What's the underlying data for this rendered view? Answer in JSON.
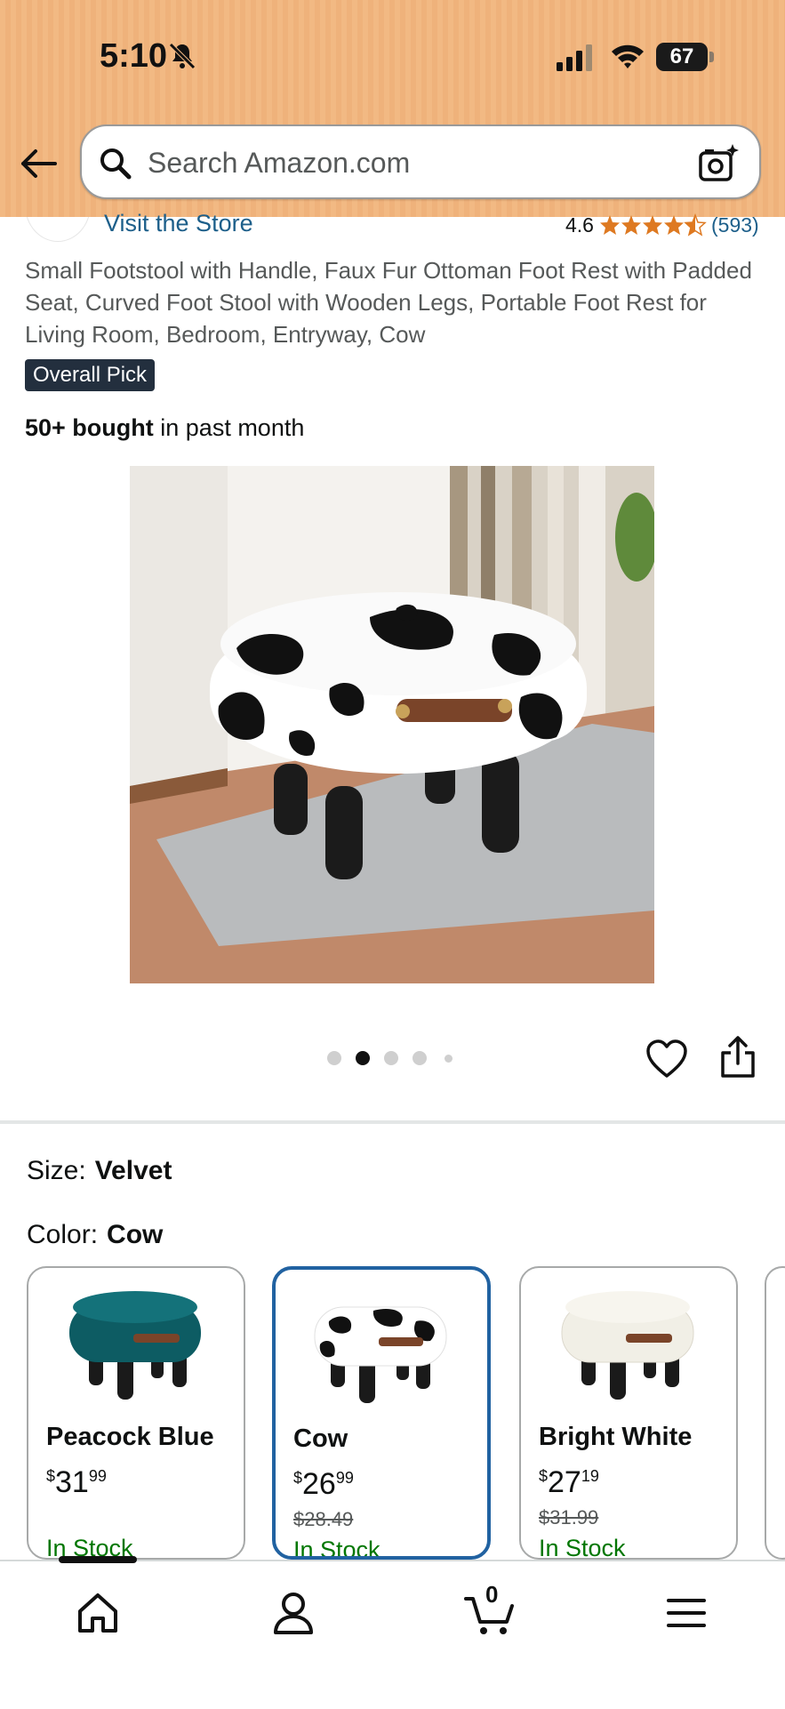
{
  "status_bar": {
    "time": "5:10",
    "battery": "67"
  },
  "search": {
    "placeholder": "Search Amazon.com"
  },
  "store": {
    "visit_label": "Visit the Store",
    "rating": "4.6",
    "review_count": "(593)",
    "stars": 4.5
  },
  "product": {
    "title": "Small Footstool with Handle, Faux Fur Ottoman Foot Rest with Padded Seat, Curved Foot Stool with Wooden Legs, Portable Foot Rest for Living Room, Bedroom, Entryway, Cow",
    "badge": "Overall Pick",
    "bought_bold": "50+ bought",
    "bought_rest": " in past month"
  },
  "carousel": {
    "total": 5,
    "active_index": 1
  },
  "size": {
    "label": "Size:",
    "value": "Velvet"
  },
  "color": {
    "label": "Color:",
    "value": "Cow"
  },
  "swatches": [
    {
      "name": "Peacock Blue",
      "price_symbol": "$",
      "price_whole": "31",
      "price_frac": "99",
      "old_price": "",
      "stock": "In Stock",
      "selected": false,
      "color": "#0d5c63"
    },
    {
      "name": "Cow",
      "price_symbol": "$",
      "price_whole": "26",
      "price_frac": "99",
      "old_price": "$28.49",
      "stock": "In Stock",
      "selected": true,
      "color": "#111111"
    },
    {
      "name": "Bright White",
      "price_symbol": "$",
      "price_whole": "27",
      "price_frac": "19",
      "old_price": "$31.99",
      "stock": "In Stock",
      "selected": false,
      "color": "#f1efe6"
    }
  ],
  "bottom_nav": {
    "cart_count": "0",
    "items": [
      "home-icon",
      "account-icon",
      "cart-icon",
      "menu-icon"
    ]
  },
  "colors": {
    "header": "#f2b983",
    "link": "#1d5f8a",
    "star": "#de7921",
    "in_stock": "#007600",
    "selected_border": "#2162a1",
    "badge_bg": "#232f3e"
  }
}
